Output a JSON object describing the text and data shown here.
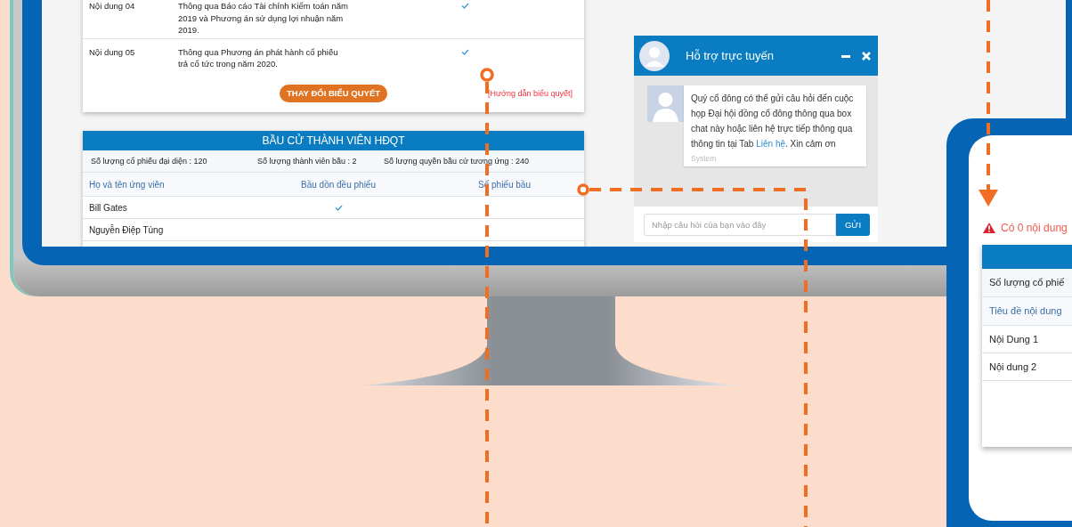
{
  "main_monitor": {
    "vote_card": {
      "rows": [
        {
          "label": "Nội dung 04",
          "content": "Thông qua Báo cáo Tài chính Kiểm toán năm 2019 và Phương án sử dụng lợi nhuận năm 2019.",
          "checked": true
        },
        {
          "label": "Nội dung 05",
          "content": "Thông qua Phương án phát hành cổ phiếu trả cổ tức trong năm 2020.",
          "checked": true
        }
      ],
      "button": "THAY ĐỔI BIỂU QUYẾT",
      "guide_link": "[Hướng dẫn biểu quyết]"
    },
    "election_card": {
      "title": "BẦU CỬ THÀNH VIÊN HĐQT",
      "stats": [
        "Số lượng cổ phiếu đại diện : 120",
        "Số lượng thành viên bầu : 2",
        "Số lượng quyền bầu cử tương ứng : 240"
      ],
      "columns": [
        "Họ và tên ứng viên",
        "Bầu dồn đều phiếu",
        "Số phiếu bầu"
      ],
      "rows": [
        {
          "name": "Bill Gates",
          "checked": true
        },
        {
          "name": "Nguyễn Điệp Tùng",
          "checked": false
        }
      ]
    },
    "chat": {
      "title": "Hỗ trợ trực tuyến",
      "message_before": "Quý cổ đông có thể gửi câu hỏi đến cuộc họp Đại hội đồng cổ đông thông qua box chat này hoặc liên hệ trực tiếp thông qua thông tin tại Tab ",
      "message_link": "Liên hệ",
      "message_after": ". Xin cảm ơn",
      "sender": "System",
      "placeholder": "Nhập câu hỏi của bạn vào đây",
      "send_button": "GỬI"
    }
  },
  "second_monitor": {
    "warning": "Có 0 nội dung",
    "stats": [
      "Số lượng cổ phiế"
    ],
    "column": "Tiêu đề nội dung",
    "rows": [
      "Nội Dung 1",
      "Nội dung 2"
    ]
  }
}
